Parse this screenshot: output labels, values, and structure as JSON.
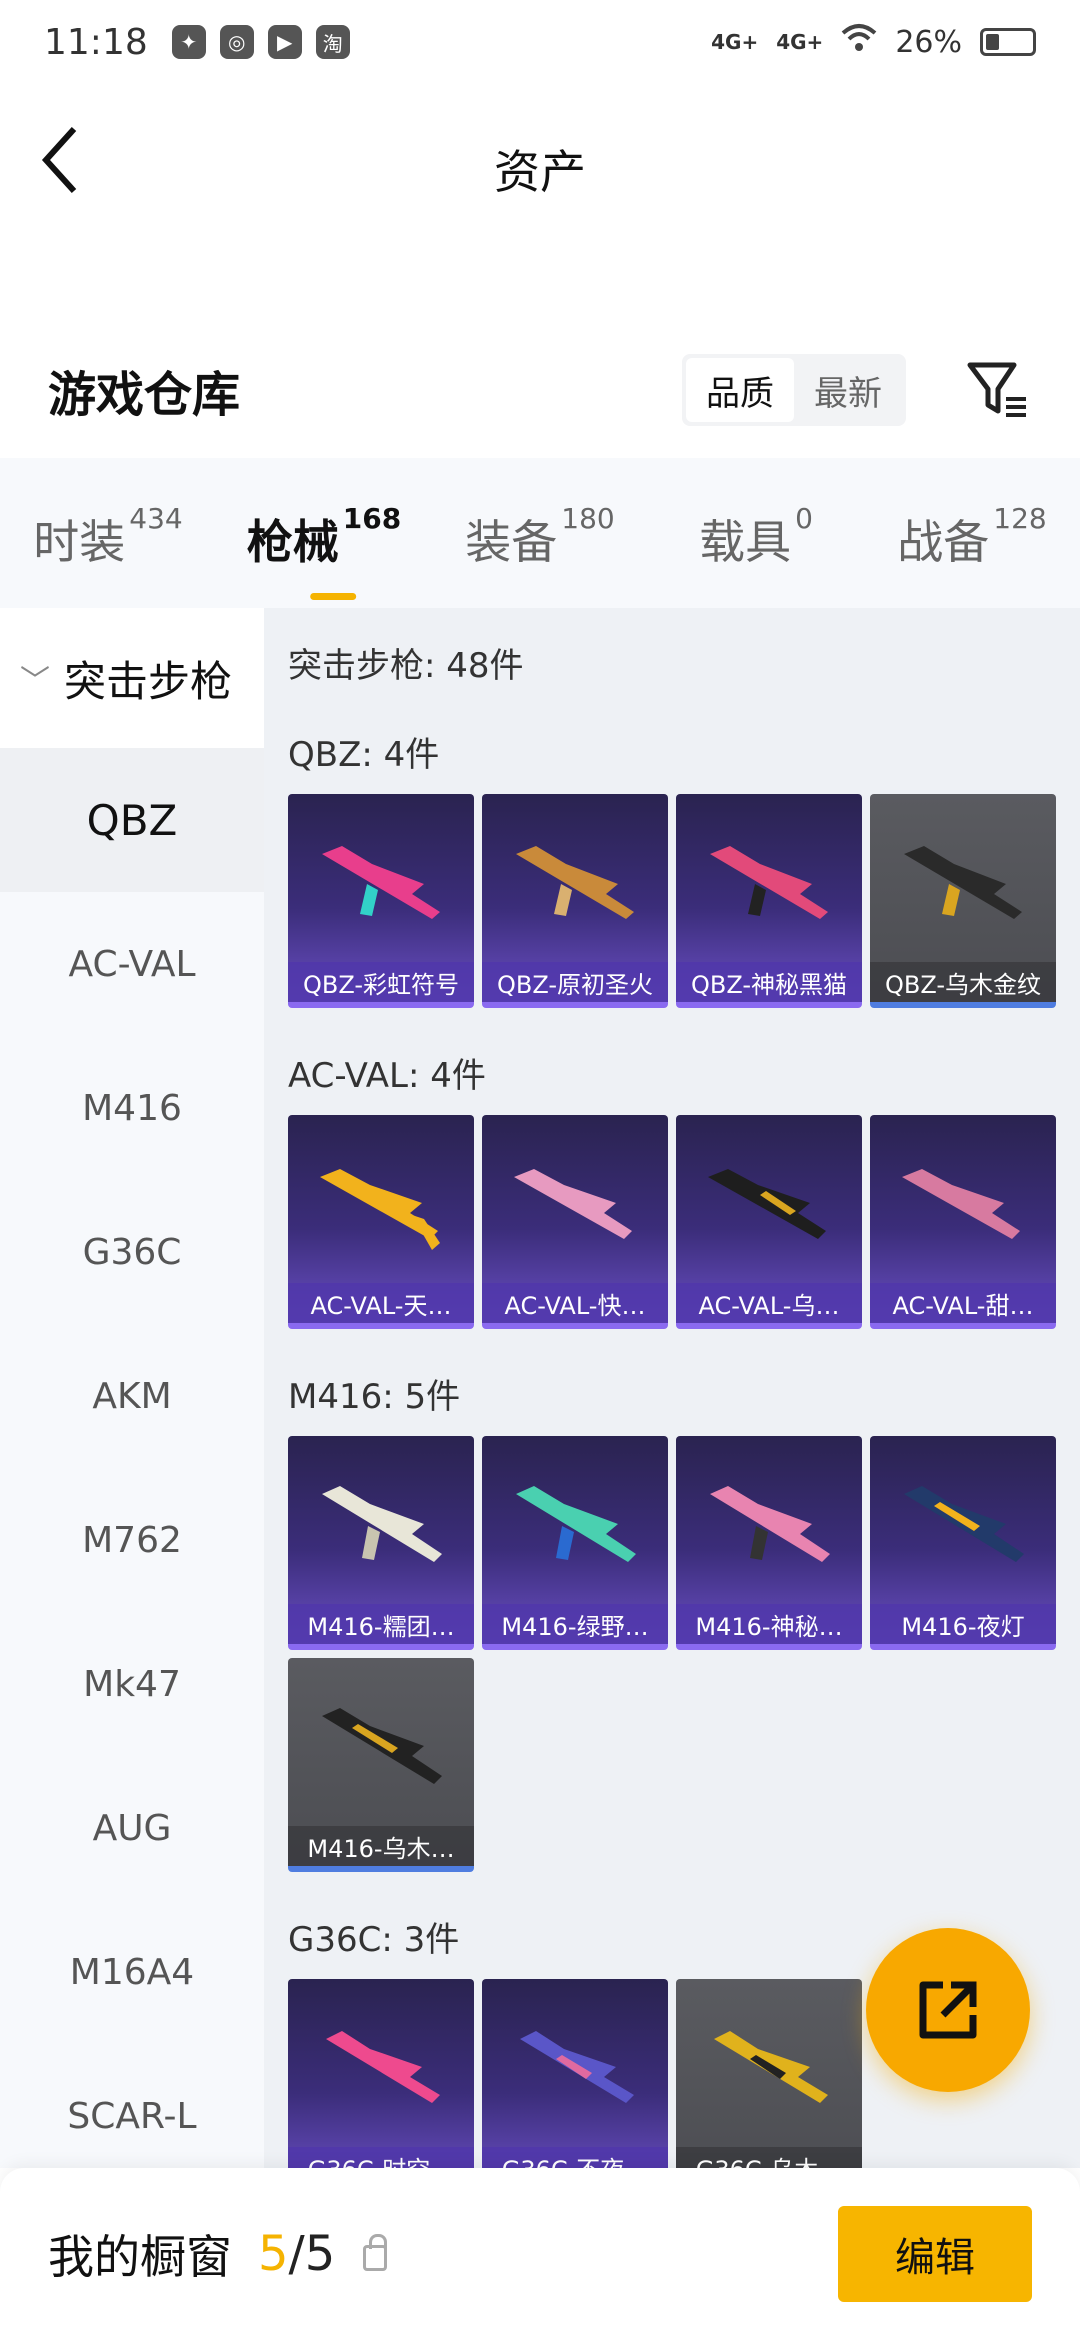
{
  "status_bar": {
    "time": "11:18",
    "signal1": "4G+",
    "signal2": "4G+",
    "battery": "26%"
  },
  "header": {
    "title": "资产"
  },
  "warehouse": {
    "title": "游戏仓库",
    "sort_quality": "品质",
    "sort_newest": "最新"
  },
  "tabs": [
    {
      "label": "时装",
      "count": "434"
    },
    {
      "label": "枪械",
      "count": "168"
    },
    {
      "label": "装备",
      "count": "180"
    },
    {
      "label": "载具",
      "count": "0"
    },
    {
      "label": "战备",
      "count": "128"
    }
  ],
  "sidebar": {
    "category": "突击步枪",
    "items": [
      "QBZ",
      "AC-VAL",
      "M416",
      "G36C",
      "AKM",
      "M762",
      "Mk47",
      "AUG",
      "M16A4",
      "SCAR-L"
    ]
  },
  "content": {
    "category_count": "突击步枪: 48件",
    "sections": [
      {
        "title": "QBZ: 4件",
        "items": [
          "QBZ-彩虹符号",
          "QBZ-原初圣火",
          "QBZ-神秘黑猫",
          "QBZ-乌木金纹"
        ]
      },
      {
        "title": "AC-VAL: 4件",
        "items": [
          "AC-VAL-天…",
          "AC-VAL-快…",
          "AC-VAL-乌…",
          "AC-VAL-甜…"
        ]
      },
      {
        "title": "M416: 5件",
        "items": [
          "M416-糯团…",
          "M416-绿野…",
          "M416-神秘…",
          "M416-夜灯",
          "M416-乌木…"
        ]
      },
      {
        "title": "G36C: 3件",
        "items": [
          "G36C-时空…",
          "G36C-不夜…",
          "G36C-乌木…"
        ]
      }
    ]
  },
  "bottom_bar": {
    "label": "我的橱窗",
    "current": "5",
    "separator": "/",
    "total": "5",
    "edit": "编辑"
  },
  "colors": {
    "accent": "#f5b301",
    "card_purple": "#3b2d7a",
    "card_gray": "#4c4d52"
  }
}
